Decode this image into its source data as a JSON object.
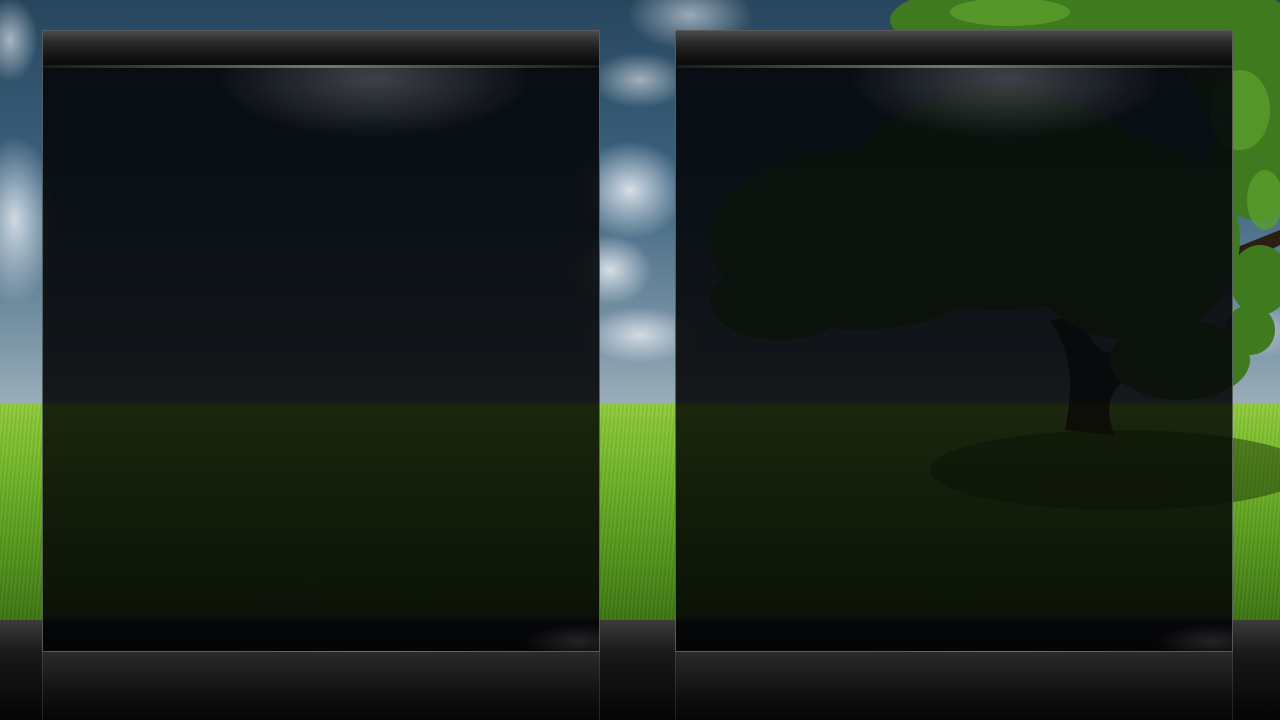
{
  "wallpaper": {
    "description_icon": "landscape-wallpaper",
    "colors": {
      "sky": "#3c6380",
      "grass": "#6eb327",
      "floor": "#151515"
    }
  },
  "panels": [
    {
      "id": "left",
      "title": ""
    },
    {
      "id": "right",
      "title": ""
    }
  ],
  "colors": {
    "panel_glass": "#06080a",
    "panel_border": "#5a5a5a",
    "accent_line": "#6d7b6f"
  }
}
